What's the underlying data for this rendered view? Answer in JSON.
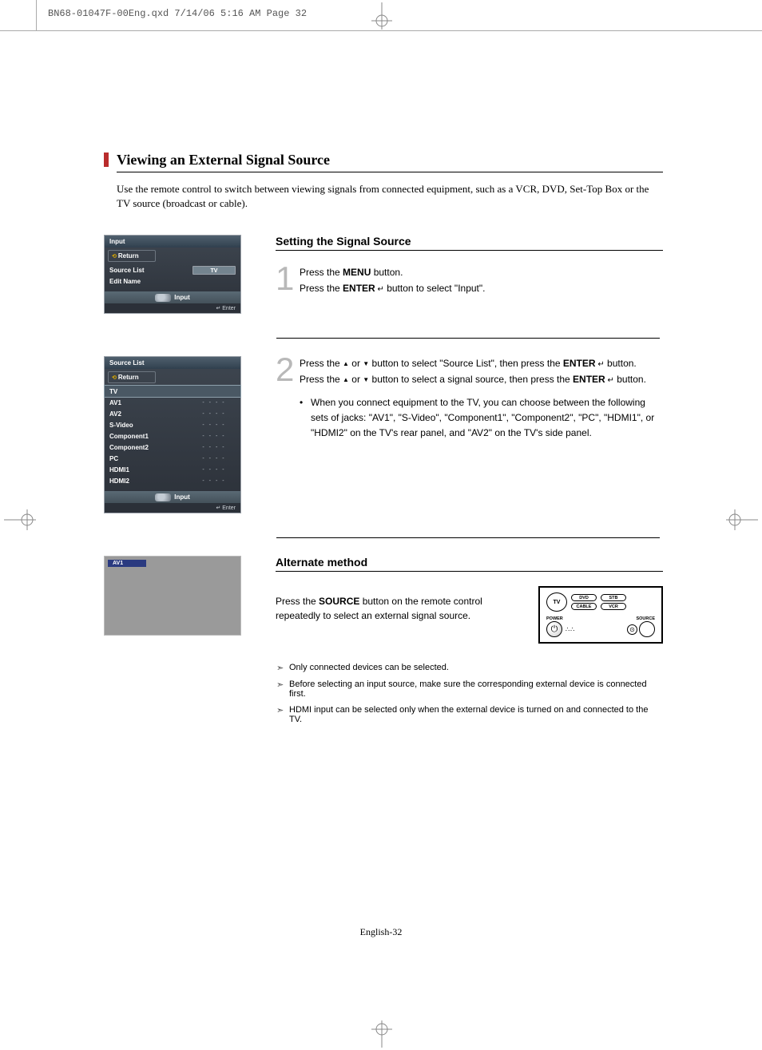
{
  "header": {
    "slug": "BN68-01047F-00Eng.qxd  7/14/06  5:16 AM  Page 32"
  },
  "title": "Viewing an External Signal Source",
  "intro": "Use the remote control to switch between viewing signals from connected equipment, such as a VCR, DVD, Set-Top Box or the TV source (broadcast or cable).",
  "section1": {
    "heading": "Setting the Signal Source"
  },
  "step1": {
    "num": "1",
    "line1a": "Press the ",
    "line1b": "MENU",
    "line1c": " button.",
    "line2a": "Press the ",
    "line2b": "ENTER",
    "line2c": " button to select \"Input\"."
  },
  "step2": {
    "num": "2",
    "l1a": "Press the ",
    "l1b": " or ",
    "l1c": " button to select \"Source List\", then press the ",
    "l1d": "ENTER",
    "l1e": " button.",
    "l2a": "Press the ",
    "l2b": " or ",
    "l2c": " button to select a signal source, then press the ",
    "l2d": "ENTER",
    "l2e": " button.",
    "bullet": "When you connect equipment to the TV, you can choose between the following sets of jacks: \"AV1\", \"S-Video\", \"Component1\", \"Component2\", \"PC\", \"HDMI1\", or \"HDMI2\" on the TV's rear panel, and \"AV2\" on the TV's side panel."
  },
  "section2": {
    "heading": "Alternate method"
  },
  "alt": {
    "t1": "Press the ",
    "t2": "SOURCE",
    "t3": " button on the remote control repeatedly to select an external signal source."
  },
  "remote": {
    "tv": "TV",
    "dvd": "DVD",
    "stb": "STB",
    "cable": "CABLE",
    "vcr": "VCR",
    "power": "POWER",
    "source": "SOURCE"
  },
  "notes": {
    "n1": "Only connected devices can be selected.",
    "n2": "Before selecting an input source, make sure the corresponding external device is connected first.",
    "n3": "HDMI input can be selected only when the external device is turned on and connected to the TV."
  },
  "osd1": {
    "title": "Input",
    "return": "Return",
    "r1": "Source List",
    "r1v": "TV",
    "r2": "Edit Name",
    "footer": "Input",
    "enter": "Enter"
  },
  "osd2": {
    "title": "Source List",
    "return": "Return",
    "rows": [
      "TV",
      "AV1",
      "AV2",
      "S-Video",
      "Component1",
      "Component2",
      "PC",
      "HDMI1",
      "HDMI2"
    ],
    "dash": "- - - -",
    "footer": "Input",
    "enter": "Enter"
  },
  "tvpanel": {
    "label": "AV1"
  },
  "pagefoot": "English-32"
}
